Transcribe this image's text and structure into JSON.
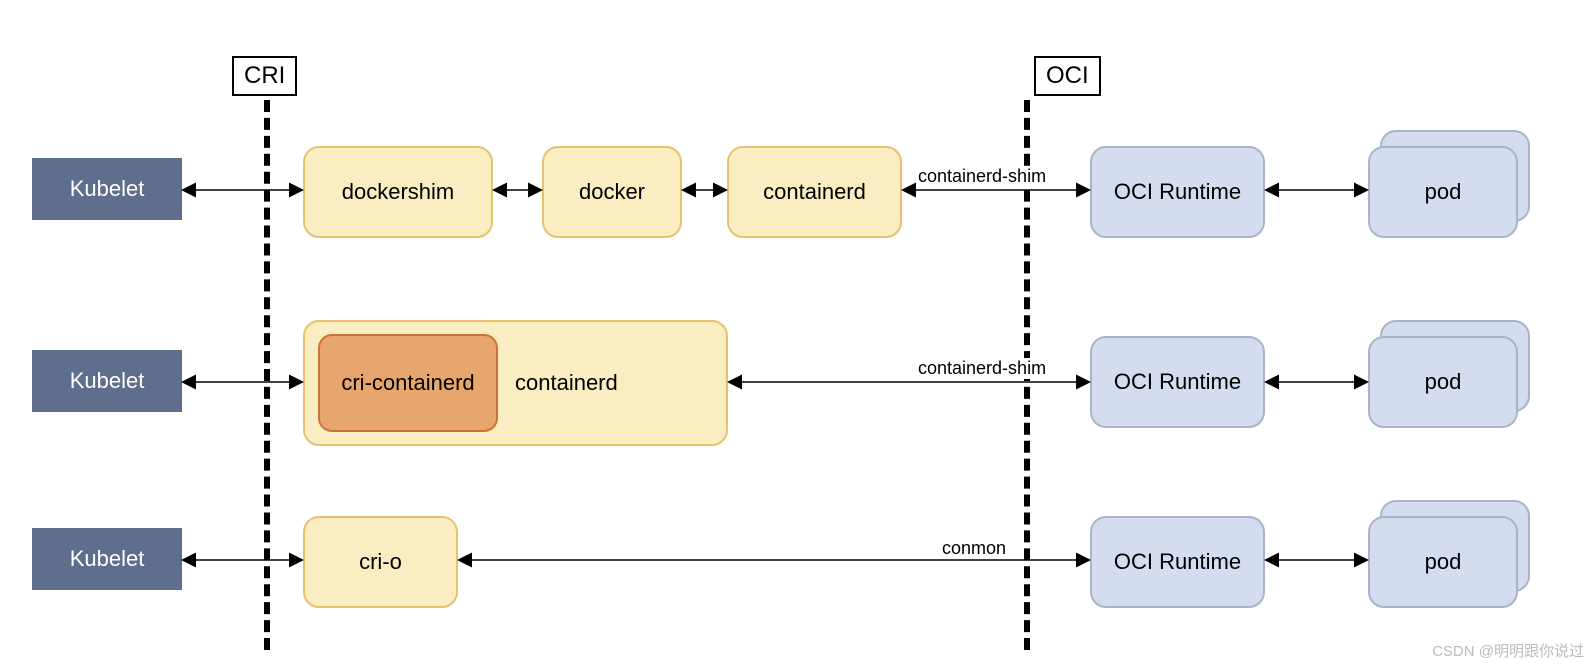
{
  "labels": {
    "cri": "CRI",
    "oci": "OCI"
  },
  "nodes": {
    "kubelet": "Kubelet",
    "dockershim": "dockershim",
    "docker": "docker",
    "containerd": "containerd",
    "cri_containerd": "cri-containerd",
    "crio": "cri-o",
    "oci_runtime": "OCI Runtime",
    "pod": "pod"
  },
  "edges": {
    "containerd_shim": "containerd-shim",
    "conmon": "conmon"
  },
  "watermark": "CSDN @明明跟你说过"
}
